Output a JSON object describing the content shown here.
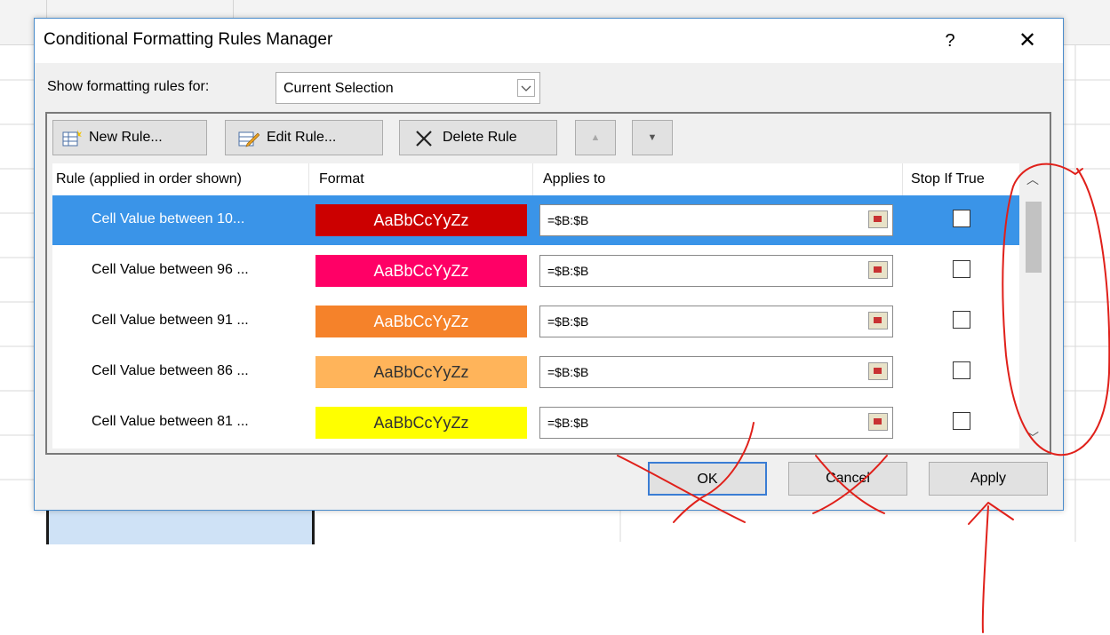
{
  "dialog": {
    "title": "Conditional Formatting Rules Manager",
    "help_label": "?",
    "close_label": "✕",
    "show_label": "Show formatting rules for:",
    "show_value": "Current Selection"
  },
  "toolbar": {
    "new_rule": "New Rule...",
    "edit_rule": "Edit Rule...",
    "delete_rule": "Delete Rule",
    "move_up": "▲",
    "move_down": "▼"
  },
  "columns": {
    "rule": "Rule (applied in order shown)",
    "format": "Format",
    "applies": "Applies to",
    "stop": "Stop If True"
  },
  "rules": [
    {
      "name": "Cell Value between 10...",
      "preview": "AaBbCcYyZz",
      "fill": "#cc0000",
      "text_color": "#ffffff",
      "applies_to": "=$B:$B",
      "stop_if_true": false,
      "selected": true
    },
    {
      "name": "Cell Value between 96 ...",
      "preview": "AaBbCcYyZz",
      "fill": "#ff0066",
      "text_color": "#ffffff",
      "applies_to": "=$B:$B",
      "stop_if_true": false,
      "selected": false
    },
    {
      "name": "Cell Value between 91 ...",
      "preview": "AaBbCcYyZz",
      "fill": "#f5822a",
      "text_color": "#ffffff",
      "applies_to": "=$B:$B",
      "stop_if_true": false,
      "selected": false
    },
    {
      "name": "Cell Value between 86 ...",
      "preview": "AaBbCcYyZz",
      "fill": "#ffb45a",
      "text_color": "#333333",
      "applies_to": "=$B:$B",
      "stop_if_true": false,
      "selected": false
    },
    {
      "name": "Cell Value between 81 ...",
      "preview": "AaBbCcYyZz",
      "fill": "#ffff00",
      "text_color": "#333333",
      "applies_to": "=$B:$B",
      "stop_if_true": false,
      "selected": false
    }
  ],
  "buttons": {
    "ok": "OK",
    "cancel": "Cancel",
    "apply": "Apply"
  },
  "colors": {
    "selection": "#3a94e8",
    "annotation": "#e0201a",
    "dialog_border": "#4a8ccc"
  }
}
